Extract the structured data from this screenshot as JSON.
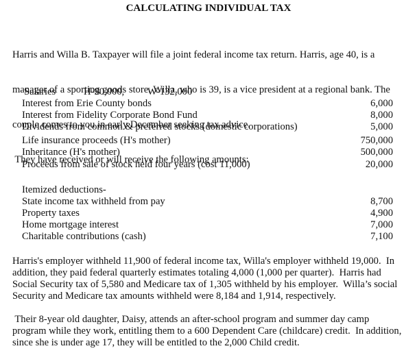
{
  "title": "CALCULATING INDIVIDUAL TAX",
  "intro_lines": [
    "Harris and Willa B. Taxpayer will file a joint federal income tax return. Harris, age 40, is a",
    "manager of a sporting goods store. Willa, who is 39, is a vice president at a regional bank. The",
    "couple comes to you in early December seeking tax advice.",
    " They have received or will receive the following amounts:"
  ],
  "salaries": {
    "label": "Salaries",
    "harris": "H-90,000,",
    "willa": "W-132,000"
  },
  "income_items": [
    {
      "label": "Interest from Erie County bonds",
      "amount": "6,000"
    },
    {
      "label": "Interest from Fidelity Corporate Bond Fund",
      "amount": "8,000"
    },
    {
      "label": "Dividends from common & preferred stocks (domestic corporations)",
      "amount": "5,000"
    },
    {
      "label": "Life insurance proceeds (H's mother)",
      "amount": "750,000"
    },
    {
      "label": "Inheritance (H's mother)",
      "amount": "500,000"
    },
    {
      "label": "Proceeds from sale of stock held four years (cost 11,000)",
      "amount": "20,000"
    }
  ],
  "deductions_heading": "Itemized deductions-",
  "deduction_items": [
    {
      "label": "State income tax withheld from pay",
      "amount": "8,700"
    },
    {
      "label": "Property taxes",
      "amount": "4,900"
    },
    {
      "label": "Home mortgage interest",
      "amount": "7,000"
    },
    {
      "label": "Charitable contributions (cash)",
      "amount": "7,100"
    }
  ],
  "withholding_lines": [
    "Harris's employer withheld 11,900 of federal income tax, Willa's employer withheld 19,000.  In",
    "addition, they paid federal quarterly estimates totaling 4,000 (1,000 per quarter).  Harris had",
    "Social Security tax of 5,580 and Medicare tax of 1,305 withheld by his employer.  Willa’s social",
    "Security and Medicare tax amounts withheld were 8,184 and 1,914, respectively."
  ],
  "credits_lines": [
    " Their 8-year old daughter, Daisy, attends an after-school program and summer day camp",
    "program while they work, entitling them to a 600 Dependent Care (childcare) credit.  In addition,",
    "since she is under age 17, they will be entitled to the 2,000 Child credit."
  ]
}
